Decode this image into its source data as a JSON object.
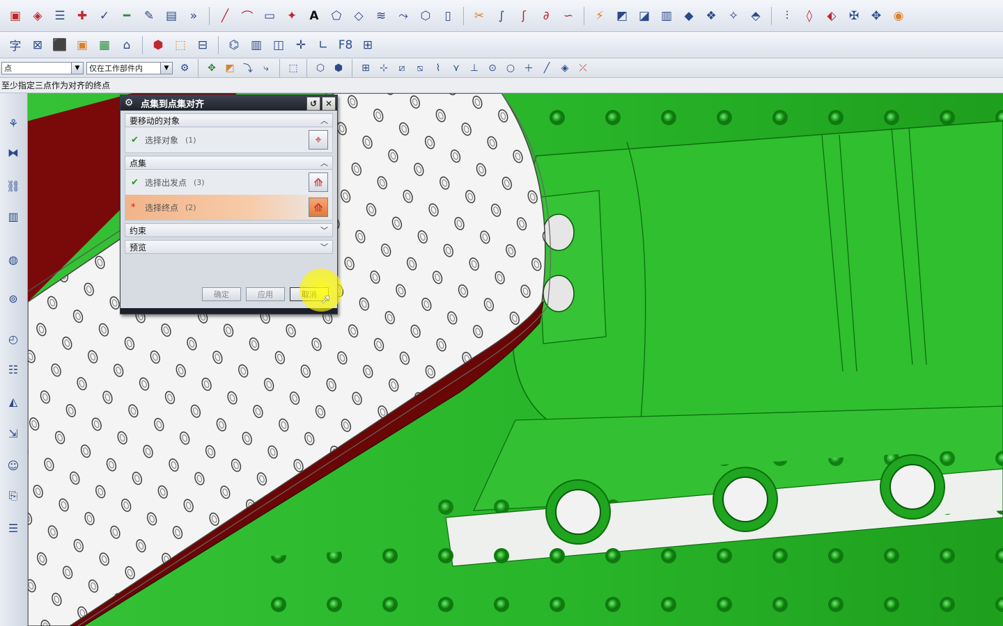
{
  "toolbar": {
    "filter_combo": "点",
    "scope_combo": "仅在工作部件内",
    "text_tool": "A",
    "row2_text1": "字",
    "row2_text2": "F8"
  },
  "status": {
    "prompt": "至少指定三点作为对齐的终点"
  },
  "dialog": {
    "title": "点集到点集对齐",
    "sections": {
      "move_objects": "要移动的对象",
      "point_set": "点集",
      "constraints": "约束",
      "preview": "预览"
    },
    "rows": {
      "select_object": {
        "label": "选择对象",
        "count": "(1)"
      },
      "select_from": {
        "label": "选择出发点",
        "count": "(3)"
      },
      "select_to": {
        "label": "选择终点",
        "count": "(2)"
      }
    },
    "buttons": {
      "ok": "确定",
      "apply": "应用",
      "cancel": "取消"
    }
  },
  "colors": {
    "model_green": "#2da52d",
    "plate_white": "#f4f4f4",
    "frame_red": "#7a0a0a",
    "highlight": "#f3b080"
  }
}
